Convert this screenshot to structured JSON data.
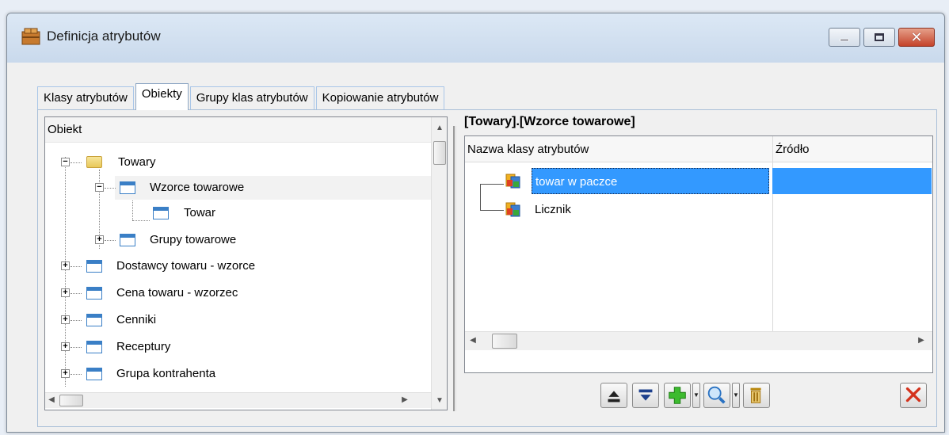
{
  "window": {
    "title": "Definicja atrybutów"
  },
  "tabs": [
    {
      "label": "Klasy atrybutów"
    },
    {
      "label": "Obiekty"
    },
    {
      "label": "Grupy klas atrybutów"
    },
    {
      "label": "Kopiowanie atrybutów"
    }
  ],
  "active_tab": "Obiekty",
  "tree": {
    "header": "Obiekt",
    "nodes": [
      {
        "label": "Towary",
        "expander": "−",
        "icon": "folder-icon"
      },
      {
        "label": "Wzorce towarowe",
        "expander": "−",
        "icon": "window-icon"
      },
      {
        "label": "Towar",
        "expander": "",
        "icon": "window-icon"
      },
      {
        "label": "Grupy towarowe",
        "expander": "+",
        "icon": "window-icon"
      },
      {
        "label": "Dostawcy towaru - wzorce",
        "expander": "+",
        "icon": "window-icon"
      },
      {
        "label": "Cena towaru - wzorzec",
        "expander": "+",
        "icon": "window-icon"
      },
      {
        "label": "Cenniki",
        "expander": "+",
        "icon": "window-icon"
      },
      {
        "label": "Receptury",
        "expander": "+",
        "icon": "window-icon"
      },
      {
        "label": "Grupa kontrahenta",
        "expander": "+",
        "icon": "window-icon"
      }
    ]
  },
  "right": {
    "title": "[Towary].[Wzorce towarowe]",
    "columns": [
      "Nazwa klasy atrybutów",
      "Źródło"
    ],
    "rows": [
      {
        "name": "towar w paczce",
        "source": "",
        "selected": true
      },
      {
        "name": "Licznik",
        "source": "",
        "selected": false
      }
    ]
  },
  "toolbar": {
    "buttons": [
      "export-icon",
      "import-icon",
      "add-icon",
      "search-icon",
      "delete-icon",
      "close-icon"
    ]
  },
  "colors": {
    "selection": "#3399ff",
    "tab_border": "#a9c6e8",
    "add_green": "#3dbb2f",
    "close_red": "#d4321c"
  }
}
